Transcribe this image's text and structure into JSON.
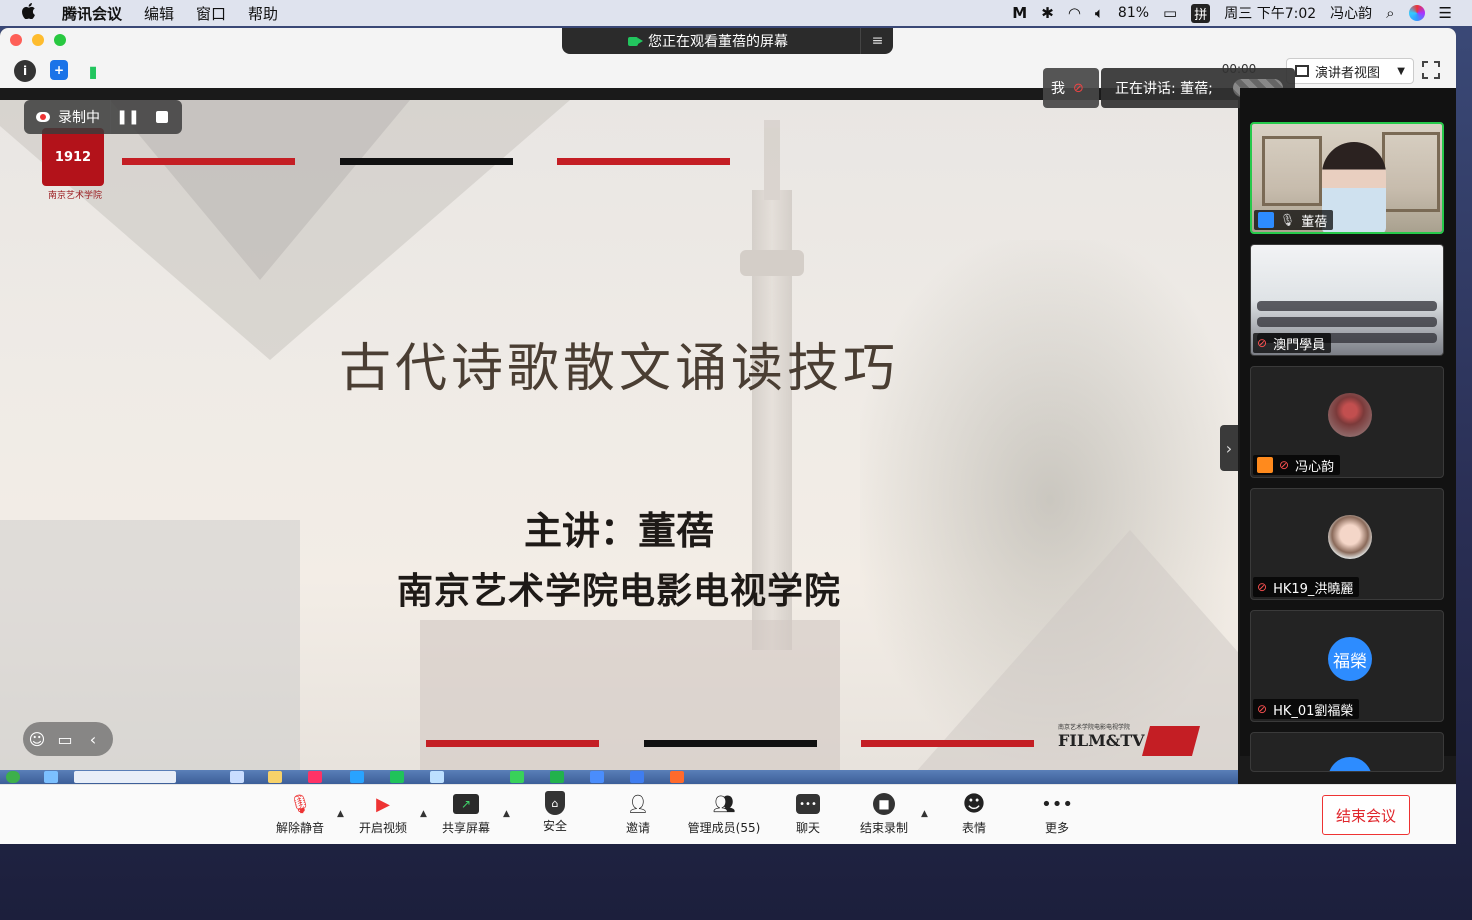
{
  "menubar": {
    "apple": "",
    "app": "腾讯会议",
    "items": [
      "编辑",
      "窗口",
      "帮助"
    ],
    "battery": "81%",
    "input_method": "拼",
    "clock": "周三 下午7:02",
    "user": "冯心韵"
  },
  "share_banner": {
    "text": "您正在观看董蓓的屏幕",
    "menu_icon": "≡"
  },
  "titlebar": {
    "timer": "00:00",
    "view_mode": "演讲者视图"
  },
  "recording": {
    "label": "录制中"
  },
  "speaking": {
    "me": "我",
    "text": "正在讲话: 董蓓;"
  },
  "slide": {
    "logo_text": "1912",
    "logo_caption": "南京艺术学院",
    "title": "古代诗歌散文诵读技巧",
    "speaker": "主讲：董蓓",
    "school": "南京艺术学院电影电视学院",
    "film_small": "南京艺术学院电影电视学院",
    "film_big": "FILM&TV"
  },
  "participants": [
    {
      "name": "董蓓",
      "kind": "video",
      "mic": "on",
      "avatar_color": "#2d8cff",
      "active": true
    },
    {
      "name": "澳門學員",
      "kind": "classroom",
      "mic": "muted",
      "active": false
    },
    {
      "name": "冯心韵",
      "kind": "photo",
      "mic": "muted",
      "avatar_color": "#ff8a1d",
      "active": false
    },
    {
      "name": "HK19_洪曉麗",
      "kind": "photo",
      "mic": "muted",
      "active": false
    },
    {
      "name": "HK_01劉福榮",
      "kind": "initials",
      "initials": "福榮",
      "mic": "muted",
      "active": false
    }
  ],
  "toolbar": {
    "unmute": "解除静音",
    "video": "开启视频",
    "share": "共享屏幕",
    "security": "安全",
    "invite": "邀请",
    "members": "管理成员(55)",
    "chat": "聊天",
    "stop_record": "结束录制",
    "reactions": "表情",
    "more": "更多",
    "end": "结束会议"
  },
  "colors": {
    "accent_red": "#c41e24",
    "active_green": "#26c94b",
    "zoom_blue": "#2d8cff"
  }
}
